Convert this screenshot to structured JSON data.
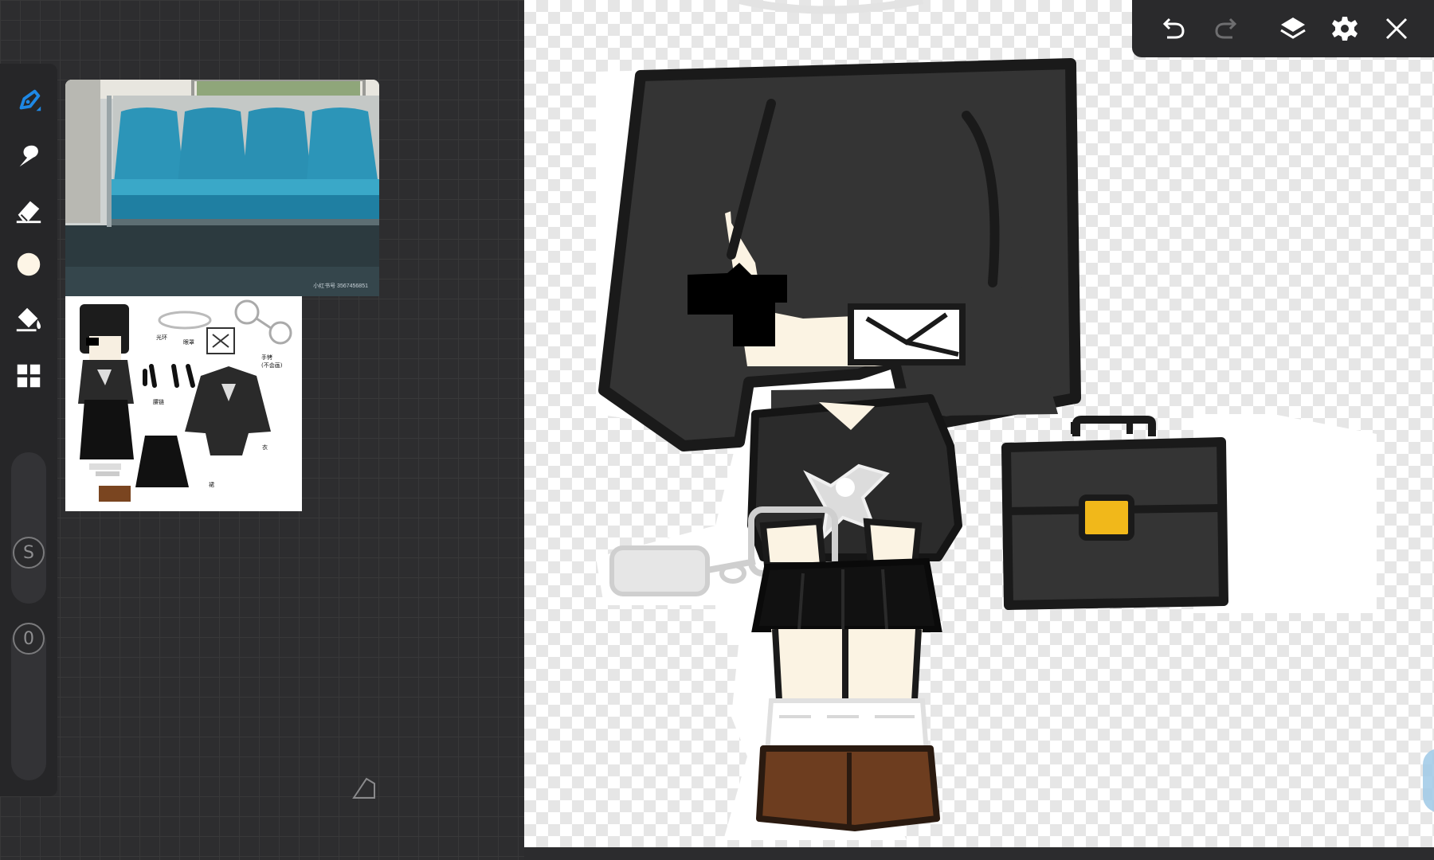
{
  "app": {
    "accent_color": "#1e88e5",
    "canvas_background": "transparent-checker"
  },
  "tools": [
    {
      "name": "brush-tool",
      "icon": "pen-icon",
      "active": true
    },
    {
      "name": "smudge-tool",
      "icon": "smudge-icon",
      "active": false
    },
    {
      "name": "eraser-tool",
      "icon": "eraser-icon",
      "active": false
    },
    {
      "name": "color-picker",
      "icon": "color-swatch-icon",
      "color": "#fdf5e6",
      "active": false
    },
    {
      "name": "fill-tool",
      "icon": "paint-bucket-icon",
      "active": false
    },
    {
      "name": "gallery-tool",
      "icon": "grid-icon",
      "active": false
    }
  ],
  "sliders": {
    "size_label": "S",
    "opacity_label": "0"
  },
  "toolbar": {
    "undo_icon": "undo-icon",
    "redo_icon": "redo-icon",
    "layers_icon": "layers-icon",
    "settings_icon": "gear-icon",
    "close_icon": "close-icon"
  },
  "reference_photo": {
    "watermark": "小红书号 3567456851",
    "badge": "≋≋≋"
  },
  "reference_sheet": {
    "labels": [
      "光环",
      "眼罩",
      "手铐\n(不会画)",
      "腰链",
      "衣",
      "裙"
    ]
  }
}
